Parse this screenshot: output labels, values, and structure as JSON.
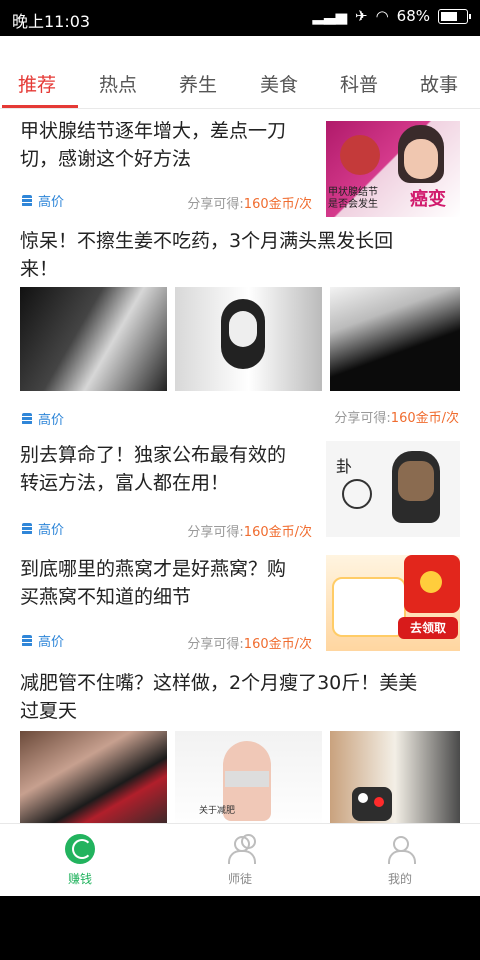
{
  "status_bar": {
    "time": "晚上11:03",
    "battery": "68%"
  },
  "tabs": [
    "推荐",
    "热点",
    "养生",
    "美食",
    "科普",
    "故事"
  ],
  "active_tab": 0,
  "feed": [
    {
      "title_line1": "甲状腺结节逐年增大，差点一刀",
      "title_line2": "切，感谢这个好方法",
      "tag": "高价",
      "share_prefix": "分享可得:",
      "share_value": "160金币/次",
      "image_text": [
        "甲状腺结节",
        "是否会发生",
        "癌变"
      ]
    },
    {
      "title_line1": "惊呆！不擦生姜不吃药，3个月满头黑发长回",
      "title_line2": "来！",
      "tag": "高价",
      "share_prefix": "分享可得:",
      "share_value": "160金币/次"
    },
    {
      "title_line1": "别去算命了！独家公布最有效的",
      "title_line2": "转运方法，富人都在用！",
      "tag": "高价",
      "share_prefix": "分享可得:",
      "share_value": "160金币/次"
    },
    {
      "title_line1": "到底哪里的燕窝才是好燕窝？购",
      "title_line2": "买燕窝不知道的细节",
      "tag": "高价",
      "share_prefix": "分享可得:",
      "share_value": "160金币/次",
      "image_text": [
        "去领取"
      ]
    },
    {
      "title_line1": "减肥管不住嘴？这样做，2个月瘦了30斤！美美",
      "title_line2": "过夏天",
      "tag": "",
      "share_prefix": "",
      "share_value": ""
    }
  ],
  "bottom_nav": [
    {
      "label": "赚钱",
      "icon": "refresh-icon",
      "active": true
    },
    {
      "label": "师徒",
      "icon": "people-icon",
      "active": false
    },
    {
      "label": "我的",
      "icon": "person-icon",
      "active": false
    }
  ],
  "colors": {
    "accent": "#e53935",
    "link": "#2f86d8",
    "coin": "#f06c2f",
    "green": "#22b35e"
  }
}
